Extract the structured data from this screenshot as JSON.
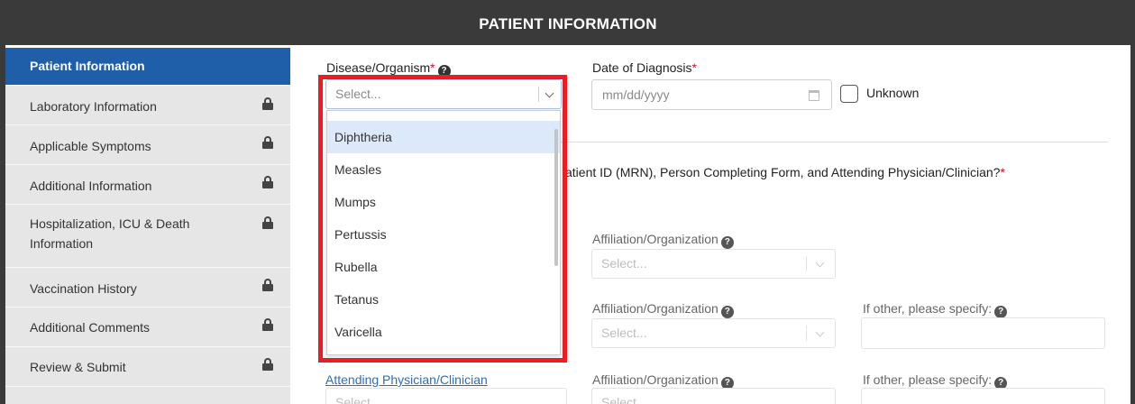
{
  "header": {
    "title": "PATIENT INFORMATION"
  },
  "sidebar": {
    "items": [
      {
        "label": "Patient Information",
        "active": true,
        "locked": false
      },
      {
        "label": "Laboratory Information",
        "active": false,
        "locked": true
      },
      {
        "label": "Applicable Symptoms",
        "active": false,
        "locked": true
      },
      {
        "label": "Additional Information",
        "active": false,
        "locked": true
      },
      {
        "label": "Hospitalization, ICU & Death",
        "label2": "Information",
        "active": false,
        "locked": true
      },
      {
        "label": "Vaccination History",
        "active": false,
        "locked": true
      },
      {
        "label": "Additional Comments",
        "active": false,
        "locked": true
      },
      {
        "label": "Review & Submit",
        "active": false,
        "locked": true
      }
    ]
  },
  "form": {
    "disease_label": "Disease/Organism",
    "required_mark": "*",
    "disease_placeholder": "Select...",
    "date_label": "Date of Diagnosis",
    "date_placeholder": "mm/dd/yyyy",
    "unknown_label": "Unknown",
    "question_text": "atient ID (MRN), Person Completing Form, and Attending Physician/Clinician?",
    "affiliation_label": "Affiliation/Organization",
    "if_other_label": "If other, please specify:",
    "select_placeholder": "Select...",
    "attending_link": "Attending Physician/Clinician"
  },
  "dropdown": {
    "options": [
      "Diphtheria",
      "Measles",
      "Mumps",
      "Pertussis",
      "Rubella",
      "Tetanus",
      "Varicella"
    ],
    "hovered_index": 0
  },
  "colors": {
    "header_bg": "#3a3a3a",
    "active_nav": "#1f5ea8",
    "sidebar_bg": "#e6e6e6",
    "required": "#c8102e",
    "highlight": "#ee1b24",
    "option_hover": "#dce9fb",
    "link": "#2f6db5"
  }
}
